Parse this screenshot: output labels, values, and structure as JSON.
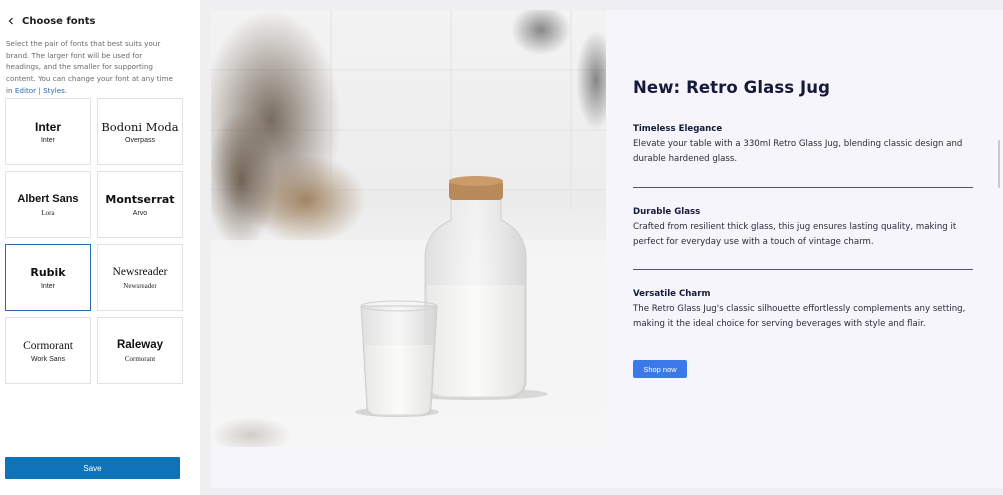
{
  "sidebar": {
    "title": "Choose fonts",
    "description_prefix": "Select the pair of fonts that best suits your brand. The larger font will be used for headings, and the smaller for supporting content. You can change your font at any time in ",
    "link_editor": "Editor",
    "separator": " | ",
    "link_styles": "Styles",
    "end": ".",
    "font_pairs": [
      {
        "heading": "Inter",
        "body": "Inter"
      },
      {
        "heading": "Bodoni Moda",
        "body": "Overpass"
      },
      {
        "heading": "Albert Sans",
        "body": "Lora"
      },
      {
        "heading": "Montserrat",
        "body": "Arvo"
      },
      {
        "heading": "Rubik",
        "body": "Inter"
      },
      {
        "heading": "Newsreader",
        "body": "Newsreader"
      },
      {
        "heading": "Cormorant",
        "body": "Work Sans"
      },
      {
        "heading": "Raleway",
        "body": "Cormorant"
      }
    ],
    "selected_index": 4,
    "save_label": "Save"
  },
  "preview": {
    "title": "New: Retro Glass Jug",
    "sections": [
      {
        "heading": "Timeless Elegance",
        "text": "Elevate your table with a 330ml Retro Glass Jug, blending classic design and durable hardened glass."
      },
      {
        "heading": "Durable Glass",
        "text": "Crafted from resilient thick glass, this jug ensures lasting quality, making it perfect for everyday use with a touch of vintage charm."
      },
      {
        "heading": "Versatile Charm",
        "text": "The Retro Glass Jug's classic silhouette effortlessly complements any setting, making it the ideal choice for serving beverages with style and flair."
      }
    ],
    "button_label": "Shop now"
  },
  "colors": {
    "accent": "#0f73b8",
    "selected_border": "#2a6bb0",
    "shop_button": "#3b79e8",
    "heading_text": "#161a3a"
  }
}
